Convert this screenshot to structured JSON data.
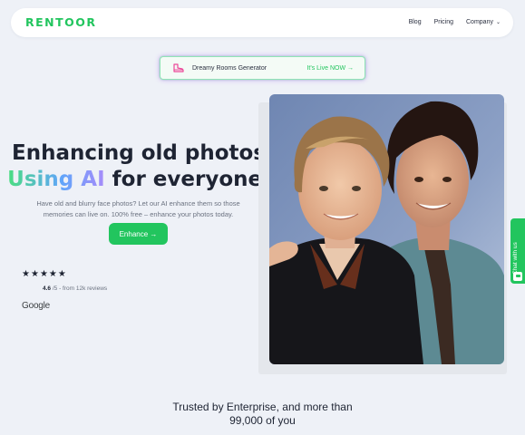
{
  "brand": "RENTOOR",
  "nav": {
    "blog": "Blog",
    "pricing": "Pricing",
    "company": "Company"
  },
  "announcement": {
    "text": "Dreamy Rooms Generator",
    "link": "It's Live NOW →"
  },
  "hero": {
    "line1": "Enhancing old photos",
    "line2_highlight": "Using AI",
    "line2_rest": " for everyone.",
    "subtitle": "Have old and blurry face photos? Let our AI enhance them so those memories can live on. 100% free – enhance your photos today.",
    "cta": "Enhance →"
  },
  "reviews": {
    "stars": 5,
    "score": "4.6",
    "suffix": " /5 - from 12k reviews",
    "source": "Google"
  },
  "chat": {
    "label": "Chat with us"
  },
  "trusted": {
    "line1": "Trusted by Enterprise, and more than",
    "line2": "99,000 of you"
  },
  "colors": {
    "accent": "#22c55e",
    "background": "#eef1f7"
  }
}
